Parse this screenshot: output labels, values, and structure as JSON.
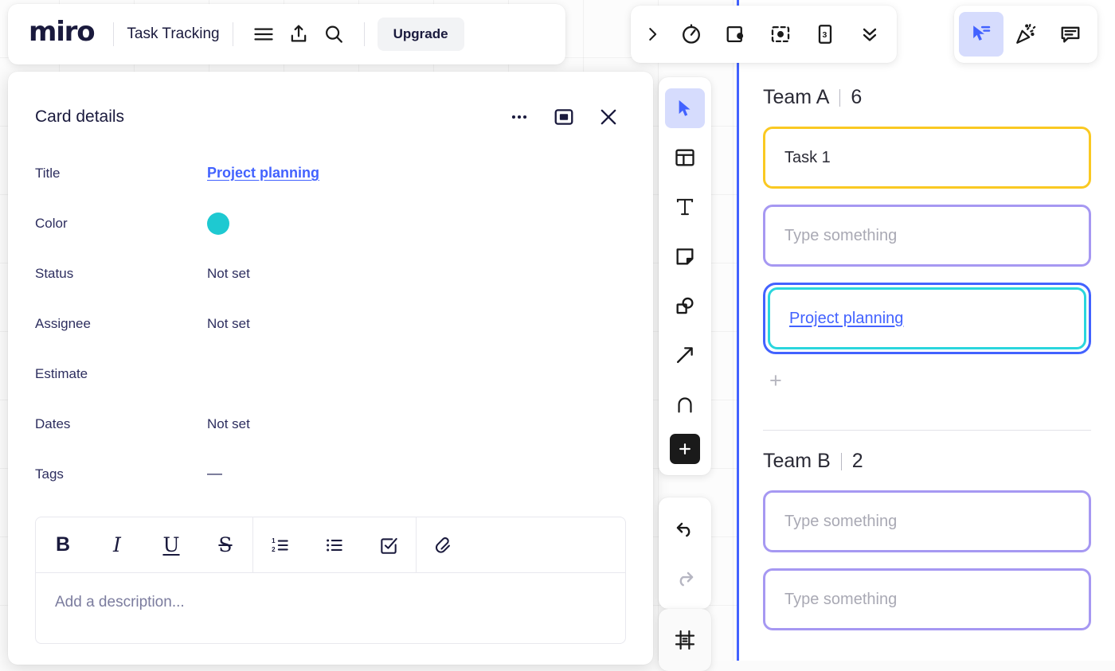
{
  "header": {
    "logo_text": "miro",
    "board_title": "Task Tracking",
    "menu_icon": "hamburger-menu-icon",
    "share_icon": "share-upload-icon",
    "search_icon": "search-icon",
    "upgrade_label": "Upgrade"
  },
  "card_panel": {
    "title": "Card details",
    "more_icon": "ellipsis-icon",
    "expand_icon": "expand-panel-icon",
    "close_icon": "close-x-icon",
    "fields": [
      {
        "label": "Title",
        "value": "Project planning",
        "kind": "link"
      },
      {
        "label": "Color",
        "value": "",
        "kind": "color",
        "color": "#1ec9d1"
      },
      {
        "label": "Status",
        "value": "Not set",
        "kind": "text"
      },
      {
        "label": "Assignee",
        "value": "Not set",
        "kind": "text"
      },
      {
        "label": "Estimate",
        "value": "",
        "kind": "text"
      },
      {
        "label": "Dates",
        "value": "Not set",
        "kind": "text"
      },
      {
        "label": "Tags",
        "value": "—",
        "kind": "dash"
      }
    ],
    "format_toolbar": [
      {
        "icon": "bold-icon",
        "glyph": "B"
      },
      {
        "icon": "italic-icon",
        "glyph": "I"
      },
      {
        "icon": "underline-icon",
        "glyph": "U"
      },
      {
        "icon": "strikethrough-icon",
        "glyph": "S"
      },
      {
        "icon": "numbered-list-icon",
        "glyph": ""
      },
      {
        "icon": "bullet-list-icon",
        "glyph": ""
      },
      {
        "icon": "checklist-icon",
        "glyph": ""
      },
      {
        "icon": "link-icon",
        "glyph": ""
      }
    ],
    "description_placeholder": "Add a description..."
  },
  "tool_rail": {
    "tools": [
      {
        "name": "cursor-select-icon",
        "active": true
      },
      {
        "name": "templates-icon",
        "active": false
      },
      {
        "name": "text-icon",
        "active": false
      },
      {
        "name": "sticky-note-icon",
        "active": false
      },
      {
        "name": "shapes-icon",
        "active": false
      },
      {
        "name": "arrow-connector-icon",
        "active": false
      },
      {
        "name": "pen-draw-icon",
        "active": false
      },
      {
        "name": "more-apps-plus-icon",
        "active": false
      }
    ],
    "undo_icon": "undo-arrow-icon",
    "redo_icon": "redo-arrow-icon",
    "frame_icon": "frame-icon"
  },
  "top_right": {
    "group1": [
      {
        "name": "chevron-right-icon"
      },
      {
        "name": "timer-icon"
      },
      {
        "name": "voting-icon"
      },
      {
        "name": "spotlight-focus-icon"
      },
      {
        "name": "card-counter-icon",
        "label": "3"
      },
      {
        "name": "chevron-double-down-icon"
      }
    ],
    "group2": [
      {
        "name": "cursor-share-icon",
        "active": true
      },
      {
        "name": "celebrate-party-icon",
        "active": false
      },
      {
        "name": "comments-icon",
        "active": false
      }
    ]
  },
  "board": {
    "groups": [
      {
        "name": "Team A",
        "count": "6",
        "cards": [
          {
            "text": "Task 1",
            "style": "yellow",
            "kind": "text",
            "selected": false
          },
          {
            "text": "Type something",
            "style": "purple",
            "kind": "placeholder",
            "selected": false
          },
          {
            "text": "Project planning",
            "style": "teal",
            "kind": "link",
            "selected": true
          }
        ],
        "add_label": "+"
      },
      {
        "name": "Team B",
        "count": "2",
        "cards": [
          {
            "text": "Type something",
            "style": "purple",
            "kind": "placeholder",
            "selected": false
          },
          {
            "text": "Type something",
            "style": "purple",
            "kind": "placeholder",
            "selected": false
          }
        ],
        "add_label": ""
      }
    ]
  },
  "colors": {
    "brand_blue": "#4262ff",
    "teal": "#1ec9d1",
    "yellow": "#fac922",
    "purple": "#a698f2",
    "card_teal_border": "#2ad6dd"
  }
}
